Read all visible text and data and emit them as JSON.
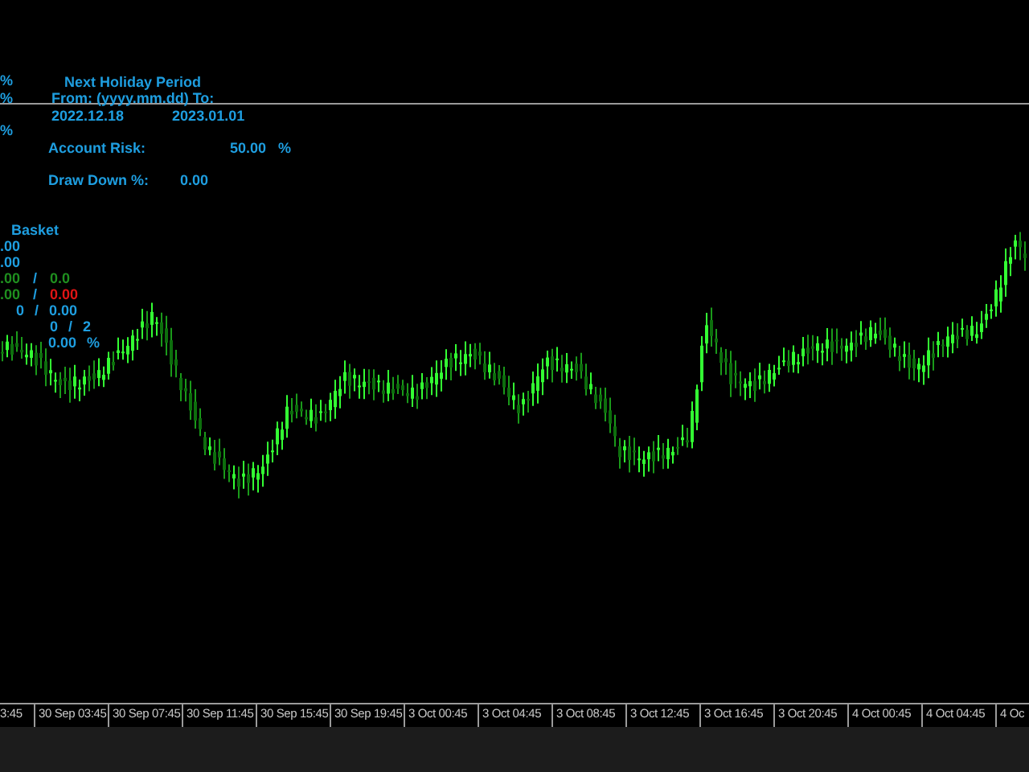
{
  "left_marks": [
    "%",
    "%",
    "%"
  ],
  "holiday_panel": {
    "title": "Next Holiday Period",
    "range_label": "From: (yyyy.mm.dd) To:",
    "from": "2022.12.18",
    "to": "2023.01.01"
  },
  "account_risk": {
    "label": "Account Risk:",
    "value": "50.00",
    "unit": "%"
  },
  "draw_down": {
    "label": "Draw Down %:",
    "value": "0.00"
  },
  "basket": {
    "title": "Basket",
    "rows": [
      {
        "kind": "text",
        "text": ".00",
        "color": "#1e9ee0"
      },
      {
        "kind": "text",
        "text": ".00",
        "color": "#1e9ee0"
      },
      {
        "kind": "split",
        "cells": [
          {
            "text": ".00",
            "color": "#1f8f1f"
          },
          {
            "text": "/",
            "color": "#1e9ee0"
          },
          {
            "text": "0.0",
            "color": "#1f8f1f"
          }
        ]
      },
      {
        "kind": "split",
        "cells": [
          {
            "text": ".00",
            "color": "#1f8f1f"
          },
          {
            "text": "/",
            "color": "#1e9ee0"
          },
          {
            "text": "0.00",
            "color": "#e01414"
          }
        ]
      },
      {
        "kind": "text",
        "text": "0 / 0.00",
        "color": "#1e9ee0"
      },
      {
        "kind": "text",
        "text": "0 / 2",
        "color": "#1e9ee0"
      },
      {
        "kind": "text",
        "text": "0.00 %",
        "color": "#1e9ee0"
      }
    ]
  },
  "time_axis": [
    "3:45",
    "30 Sep 03:45",
    "30 Sep 07:45",
    "30 Sep 11:45",
    "30 Sep 15:45",
    "30 Sep 19:45",
    "3 Oct 00:45",
    "3 Oct 04:45",
    "3 Oct 08:45",
    "3 Oct 12:45",
    "3 Oct 16:45",
    "3 Oct 20:45",
    "4 Oct 00:45",
    "4 Oct 04:45",
    "4 Oc"
  ]
}
